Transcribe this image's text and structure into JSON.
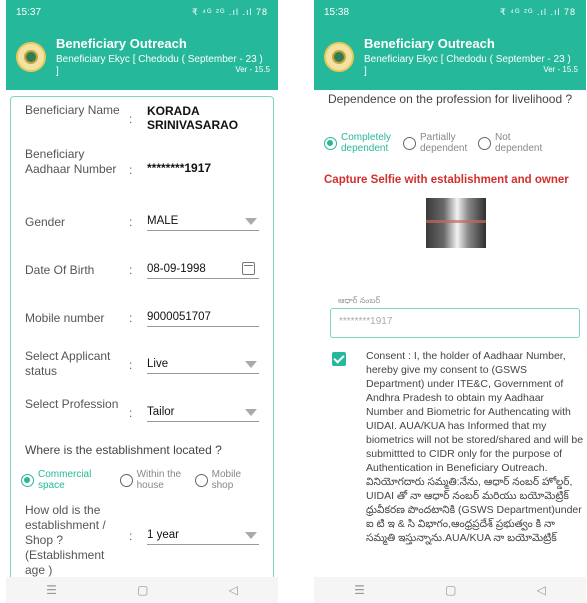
{
  "colors": {
    "accent": "#26b89a",
    "warning": "#d32f2f",
    "border": "#7fd3c2"
  },
  "left_screen": {
    "status": {
      "time": "15:37",
      "icons": "₹ ⁴ᴳ ²ᴳ .ıl .ıl 78"
    },
    "header": {
      "title": "Beneficiary Outreach",
      "subtitle": "Beneficiary Ekyc [  Chedodu ( September - 23 ) ]",
      "version": "Ver - 15.5"
    },
    "form": {
      "name_label": "Beneficiary Name",
      "name_value": "KORADA SRINIVASARAO",
      "aadhaar_label": "Beneficiary Aadhaar Number",
      "aadhaar_value": "********1917",
      "gender_label": "Gender",
      "gender_value": "MALE",
      "dob_label": "Date Of Birth",
      "dob_value": "08-09-1998",
      "mobile_label": "Mobile number",
      "mobile_value": "9000051707",
      "status_label": "Select Applicant status",
      "status_value": "Live",
      "profession_label": "Select Profession",
      "profession_value": "Tailor",
      "location_question": "Where is the establishment located ?",
      "location_options": [
        "Commercial space",
        "Within the house",
        "Mobile shop"
      ],
      "age_label": "How old is the establishment / Shop ?(Establishment age )",
      "age_value": "1 year"
    },
    "colon": ":"
  },
  "right_screen": {
    "status": {
      "time": "15:38",
      "icons": "₹ ⁴ᴳ ²ᴳ .ıl .ıl 78"
    },
    "header": {
      "title": "Beneficiary Outreach",
      "subtitle": "Beneficiary Ekyc [  Chedodu ( September - 23 ) ]",
      "version": "Ver - 15.5"
    },
    "dependence_question": "Dependence on the profession for livelihood ?",
    "dependence_options": [
      "Completely dependent",
      "Partially dependent",
      "Not dependent"
    ],
    "selfie_heading": "Capture Selfie with establishment and owner",
    "aadhaar_caption": "ఆధార్ నంబర్",
    "aadhaar_value": "********1917",
    "consent_text": "Consent : I, the holder of Aadhaar Number, hereby give my consent to (GSWS Department) under ITE&C, Government of Andhra Pradesh to obtain my Aadhaar Number and Biometric for Authencating with UIDAI. AUA/KUA has Informed that my biometrics will not be stored/shared and will be submittted to CIDR only for the purpose of Authentication in Beneficiary Outreach. వినియోగదారు సమ్మతి:నేను, ఆధార్ నంబర్ హోల్డర్, UIDAI తో నా ఆధార్ నంబర్ మరియు బయోమెట్రిక్ ధ్రువీకరణ పొందటానికి (GSWS Department)under ఐ టి ఇ & సి విభాగం,ఆంధ్రప్రదేశ్ ప్రభుత్వం కి నా సమ్మతి ఇస్తున్నాను.AUA/KUA నా బయోమెట్రిక్"
  },
  "nav": {
    "menu": "☰",
    "home": "▢",
    "back": "◁"
  }
}
